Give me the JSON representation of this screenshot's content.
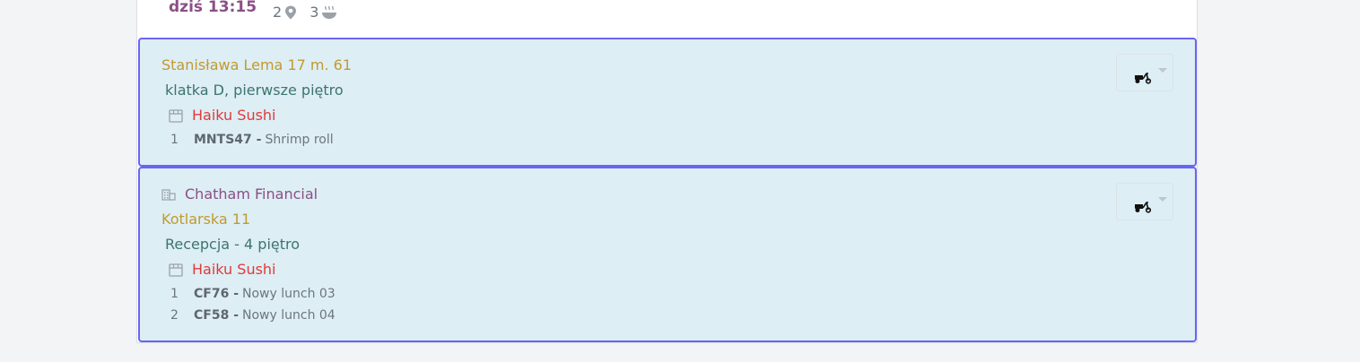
{
  "header": {
    "time": "dziś 13:15",
    "stops_count": "2",
    "dishes_count": "3"
  },
  "deliveries": [
    {
      "address": "Stanisława Lema 17 m. 61",
      "note": "klatka D, pierwsze piętro",
      "restaurant": "Haiku Sushi",
      "orders": [
        {
          "qty": "1",
          "code": "MNTS47 -",
          "name": "Shrimp roll"
        }
      ]
    },
    {
      "company": "Chatham Financial",
      "address": "Kotlarska 11",
      "note": "Recepcja - 4 piętro",
      "restaurant": "Haiku Sushi",
      "orders": [
        {
          "qty": "1",
          "code": "CF76 -",
          "name": "Nowy lunch 03"
        },
        {
          "qty": "2",
          "code": "CF58 -",
          "name": "Nowy lunch 04"
        }
      ]
    }
  ],
  "icons": {
    "location": "map-pin-icon",
    "dish": "dish-icon",
    "restaurant": "store-icon",
    "company": "building-icon",
    "courier": "scooter-icon"
  },
  "colors": {
    "card_bg": "#ddeef5",
    "card_border": "#6a63f6",
    "time": "#8a4f86",
    "address": "#c29a2f",
    "note": "#3d7470",
    "restaurant": "#e03a3a"
  }
}
